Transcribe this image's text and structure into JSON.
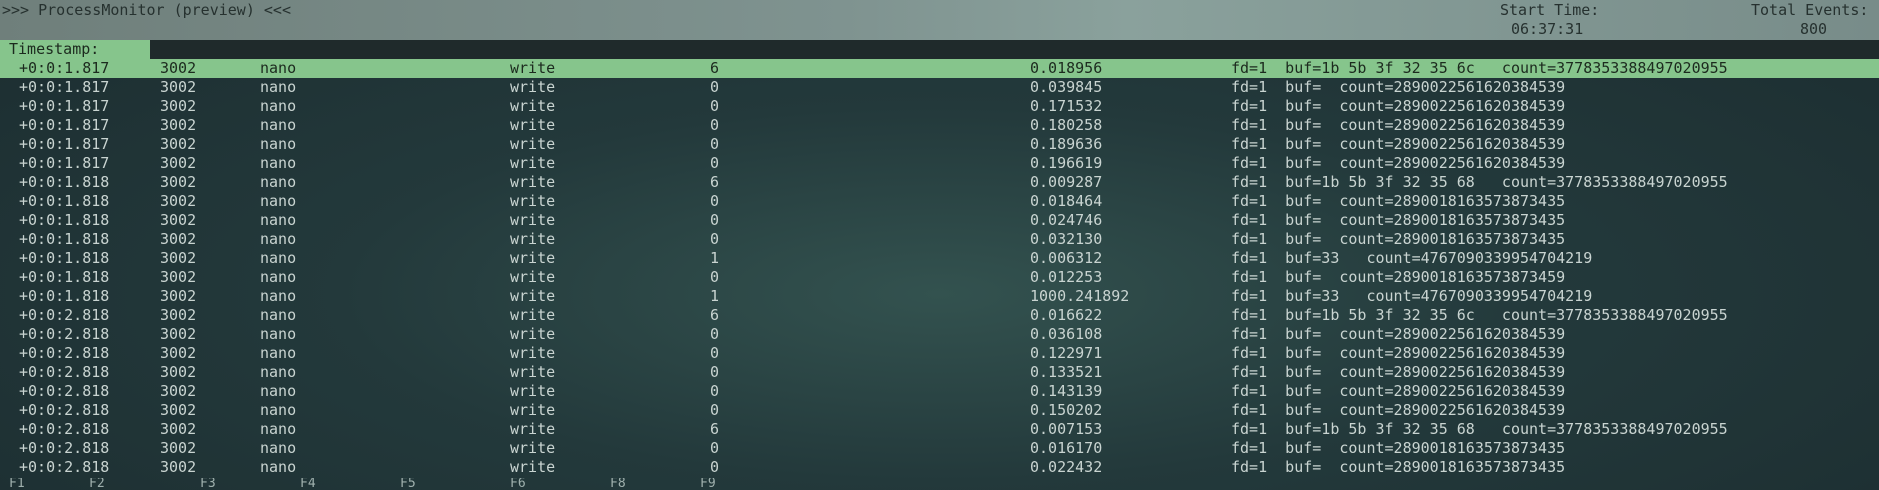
{
  "header": {
    "title": ">>> ProcessMonitor (preview) <<<",
    "start_time_label": "Start Time:",
    "start_time_value": "06:37:31",
    "total_events_label": "Total Events:",
    "total_events_value": "800"
  },
  "columns": {
    "timestamp_header": "Timestamp:"
  },
  "rows": [
    {
      "ts": "+0:0:1.817",
      "pid": "3002",
      "proc": "nano",
      "call": "write",
      "ret": "6",
      "dur": "0.018956",
      "args": "fd=1  buf=1b 5b 3f 32 35 6c   count=3778353388497020955"
    },
    {
      "ts": "+0:0:1.817",
      "pid": "3002",
      "proc": "nano",
      "call": "write",
      "ret": "0",
      "dur": "0.039845",
      "args": "fd=1  buf=  count=2890022561620384539"
    },
    {
      "ts": "+0:0:1.817",
      "pid": "3002",
      "proc": "nano",
      "call": "write",
      "ret": "0",
      "dur": "0.171532",
      "args": "fd=1  buf=  count=2890022561620384539"
    },
    {
      "ts": "+0:0:1.817",
      "pid": "3002",
      "proc": "nano",
      "call": "write",
      "ret": "0",
      "dur": "0.180258",
      "args": "fd=1  buf=  count=2890022561620384539"
    },
    {
      "ts": "+0:0:1.817",
      "pid": "3002",
      "proc": "nano",
      "call": "write",
      "ret": "0",
      "dur": "0.189636",
      "args": "fd=1  buf=  count=2890022561620384539"
    },
    {
      "ts": "+0:0:1.817",
      "pid": "3002",
      "proc": "nano",
      "call": "write",
      "ret": "0",
      "dur": "0.196619",
      "args": "fd=1  buf=  count=2890022561620384539"
    },
    {
      "ts": "+0:0:1.818",
      "pid": "3002",
      "proc": "nano",
      "call": "write",
      "ret": "6",
      "dur": "0.009287",
      "args": "fd=1  buf=1b 5b 3f 32 35 68   count=3778353388497020955"
    },
    {
      "ts": "+0:0:1.818",
      "pid": "3002",
      "proc": "nano",
      "call": "write",
      "ret": "0",
      "dur": "0.018464",
      "args": "fd=1  buf=  count=2890018163573873435"
    },
    {
      "ts": "+0:0:1.818",
      "pid": "3002",
      "proc": "nano",
      "call": "write",
      "ret": "0",
      "dur": "0.024746",
      "args": "fd=1  buf=  count=2890018163573873435"
    },
    {
      "ts": "+0:0:1.818",
      "pid": "3002",
      "proc": "nano",
      "call": "write",
      "ret": "0",
      "dur": "0.032130",
      "args": "fd=1  buf=  count=2890018163573873435"
    },
    {
      "ts": "+0:0:1.818",
      "pid": "3002",
      "proc": "nano",
      "call": "write",
      "ret": "1",
      "dur": "0.006312",
      "args": "fd=1  buf=33   count=4767090339954704219"
    },
    {
      "ts": "+0:0:1.818",
      "pid": "3002",
      "proc": "nano",
      "call": "write",
      "ret": "0",
      "dur": "0.012253",
      "args": "fd=1  buf=  count=2890018163573873459"
    },
    {
      "ts": "+0:0:1.818",
      "pid": "3002",
      "proc": "nano",
      "call": "write",
      "ret": "1",
      "dur": "1000.241892",
      "args": "fd=1  buf=33   count=4767090339954704219"
    },
    {
      "ts": "+0:0:2.818",
      "pid": "3002",
      "proc": "nano",
      "call": "write",
      "ret": "6",
      "dur": "0.016622",
      "args": "fd=1  buf=1b 5b 3f 32 35 6c   count=3778353388497020955"
    },
    {
      "ts": "+0:0:2.818",
      "pid": "3002",
      "proc": "nano",
      "call": "write",
      "ret": "0",
      "dur": "0.036108",
      "args": "fd=1  buf=  count=2890022561620384539"
    },
    {
      "ts": "+0:0:2.818",
      "pid": "3002",
      "proc": "nano",
      "call": "write",
      "ret": "0",
      "dur": "0.122971",
      "args": "fd=1  buf=  count=2890022561620384539"
    },
    {
      "ts": "+0:0:2.818",
      "pid": "3002",
      "proc": "nano",
      "call": "write",
      "ret": "0",
      "dur": "0.133521",
      "args": "fd=1  buf=  count=2890022561620384539"
    },
    {
      "ts": "+0:0:2.818",
      "pid": "3002",
      "proc": "nano",
      "call": "write",
      "ret": "0",
      "dur": "0.143139",
      "args": "fd=1  buf=  count=2890022561620384539"
    },
    {
      "ts": "+0:0:2.818",
      "pid": "3002",
      "proc": "nano",
      "call": "write",
      "ret": "0",
      "dur": "0.150202",
      "args": "fd=1  buf=  count=2890022561620384539"
    },
    {
      "ts": "+0:0:2.818",
      "pid": "3002",
      "proc": "nano",
      "call": "write",
      "ret": "6",
      "dur": "0.007153",
      "args": "fd=1  buf=1b 5b 3f 32 35 68   count=3778353388497020955"
    },
    {
      "ts": "+0:0:2.818",
      "pid": "3002",
      "proc": "nano",
      "call": "write",
      "ret": "0",
      "dur": "0.016170",
      "args": "fd=1  buf=  count=2890018163573873435"
    },
    {
      "ts": "+0:0:2.818",
      "pid": "3002",
      "proc": "nano",
      "call": "write",
      "ret": "0",
      "dur": "0.022432",
      "args": "fd=1  buf=  count=2890018163573873435"
    }
  ],
  "function_keys": [
    "F1",
    "F2",
    "F3",
    "F4",
    "F5",
    "F6",
    "F8",
    "F9"
  ]
}
